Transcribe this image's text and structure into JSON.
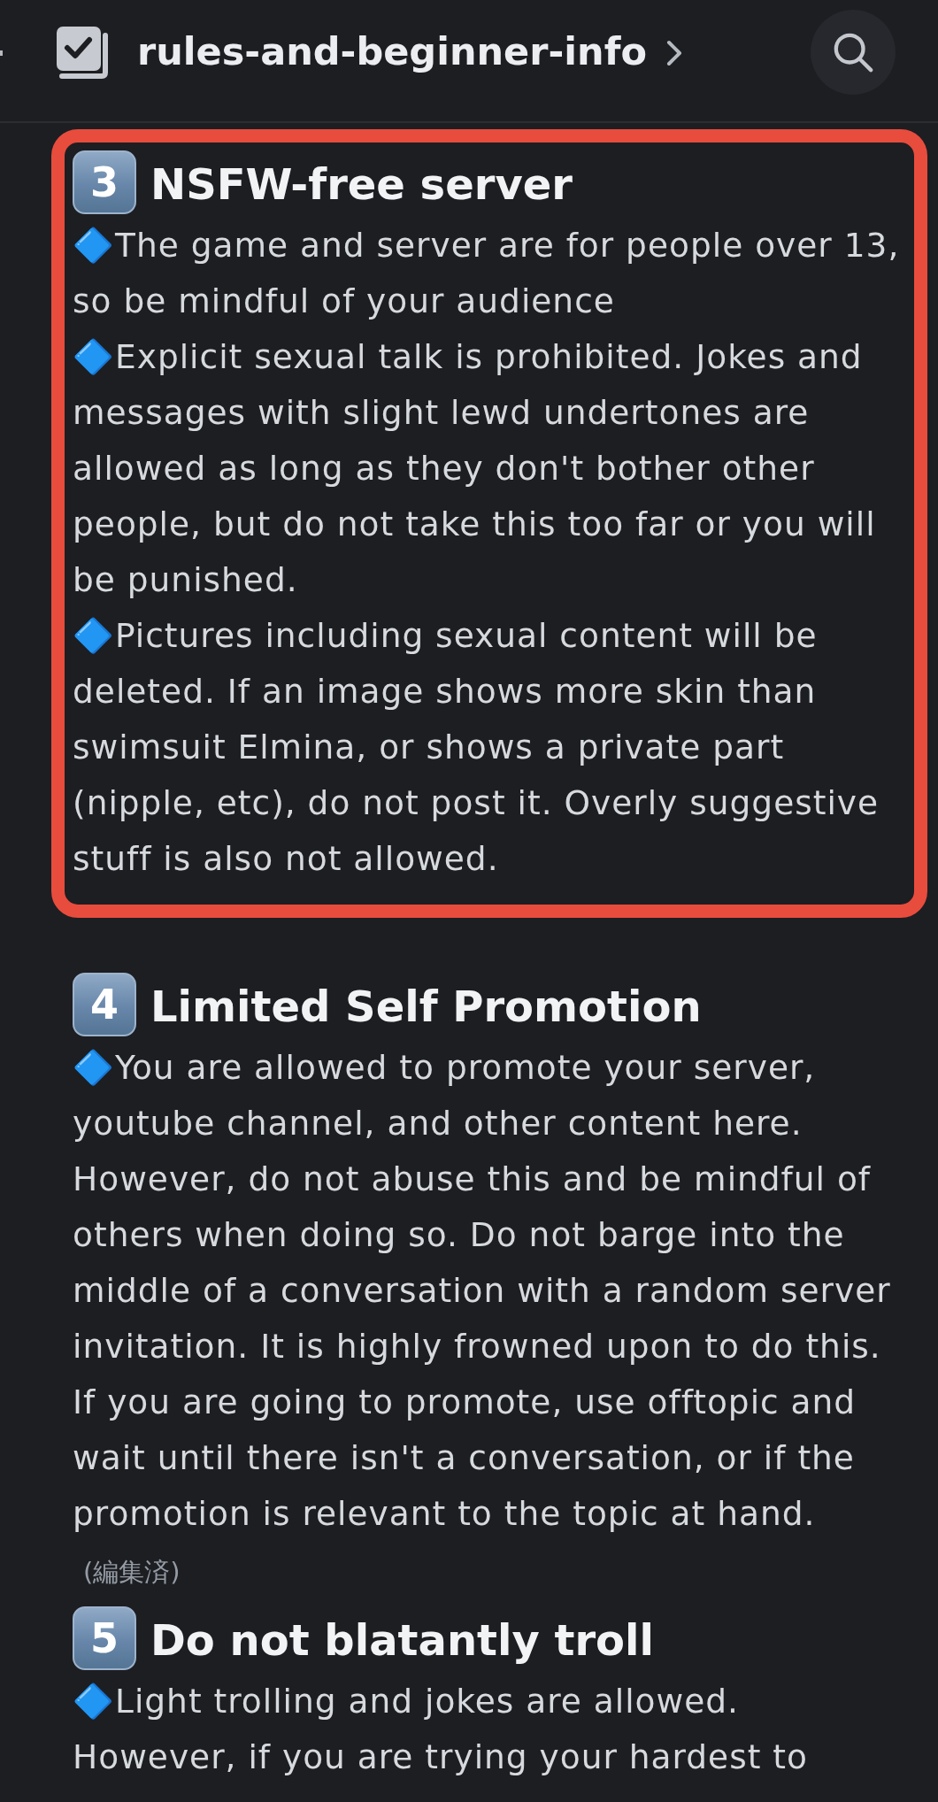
{
  "header": {
    "channel_name": "rules-and-beginner-info"
  },
  "sections": [
    {
      "number": "3",
      "title": "NSFW-free server",
      "highlighted": true,
      "paragraphs": [
        {
          "text": "🔷The game and server are for people over 13, so be mindful of your audience"
        },
        {
          "text": "🔷Explicit sexual talk is prohibited. Jokes and messages with slight lewd undertones are allowed as long as they don't bother other people, but do not take this too far or you will be punished."
        },
        {
          "text": "🔷Pictures including sexual content will be deleted. If an image shows more skin than swimsuit Elmina, or shows a private part (nipple, etc), do not post it. Overly suggestive stuff is also not allowed."
        }
      ]
    },
    {
      "number": "4",
      "title": "Limited Self Promotion",
      "highlighted": false,
      "paragraphs": [
        {
          "text": "🔷You are allowed to promote your server, youtube channel, and other content here. However, do not abuse this and be mindful of others when doing so. Do not barge into the middle of a conversation with a random server invitation. It is highly frowned upon to do this. If you are going to promote, use offtopic and wait until there isn't a conversation, or if the promotion is relevant to the topic at hand.",
          "edited_label": "(編集済)"
        }
      ]
    },
    {
      "number": "5",
      "title": "Do not blatantly troll",
      "highlighted": false,
      "paragraphs": [
        {
          "text": "🔷Light trolling and jokes are allowed. However, if you are trying your hardest to"
        }
      ]
    }
  ]
}
